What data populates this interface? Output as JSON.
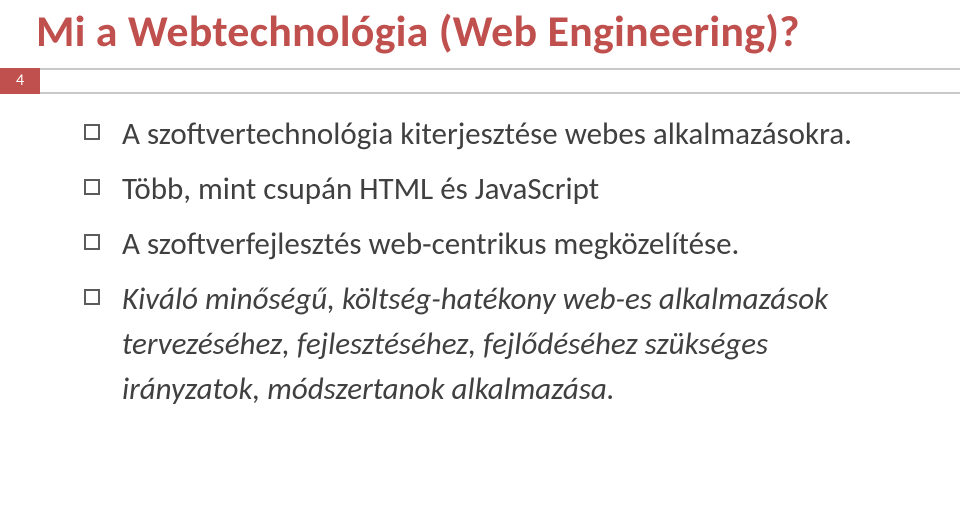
{
  "slide": {
    "title": "Mi a Webtechnológia (Web Engineering)?",
    "page_number": "4",
    "bullets": [
      {
        "text": "A szoftvertechnológia kiterjesztése webes alkalmazásokra.",
        "italic": false
      },
      {
        "text": "Több, mint csupán HTML és JavaScript",
        "italic": false
      },
      {
        "text": "A szoftverfejlesztés web-centrikus megközelítése.",
        "italic": false
      },
      {
        "text": "Kiváló minőségű, költség-hatékony web-es alkalmazások tervezéséhez, fejlesztéséhez, fejlődéséhez szükséges irányzatok, módszertanok alkalmazása.",
        "italic": true
      }
    ],
    "colors": {
      "accent": "#c0504d",
      "body_text": "#404040",
      "band_border": "#c9c9c9"
    }
  }
}
